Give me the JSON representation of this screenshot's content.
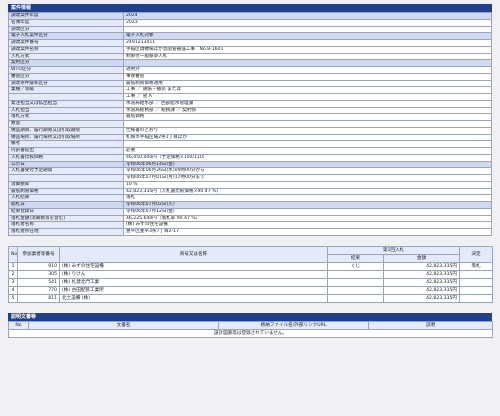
{
  "section_title": "案件情報",
  "info_rows": [
    {
      "label": "調達案件年度",
      "value": "2024",
      "hl": true
    },
    {
      "label": "名簿年度",
      "value": "2023"
    },
    {
      "label": "調達区分",
      "value": ""
    },
    {
      "label": "電子入札案件区分",
      "value": "電子入札対象",
      "hl": true
    },
    {
      "label": "調達案件番号",
      "value": "2491213411"
    },
    {
      "label": "調達案件名称",
      "value": "手稲区瑞穂場ほか急閉管補強工事　No.8-1601"
    },
    {
      "label": "入札方式",
      "value": "制限付一般競争入札"
    },
    {
      "label": "契約区分",
      "value": "",
      "hl": true
    },
    {
      "label": "WTO区分",
      "value": "適用外"
    },
    {
      "label": "審査区分",
      "value": "事後審査"
    },
    {
      "label": "調達条件緩和区分",
      "value": "最低制限価格適用"
    },
    {
      "label": "業種／等級",
      "value": "工事 ／ 鉄筋・播装 または"
    },
    {
      "label": "",
      "value": "工事 ／ 管 A"
    },
    {
      "label": "発注担当又は払出担当",
      "value": "水道局給水部 ／ 西部配水管理課"
    },
    {
      "label": "入札担当",
      "value": "水道局総務部 ／ 総務課 ／ 契約係"
    },
    {
      "label": "落札方式",
      "value": "最低価格"
    },
    {
      "label": "数量",
      "value": ""
    },
    {
      "label": "納品期限、履行期限又は引取期限",
      "value": "仕様書のとおり"
    },
    {
      "label": "納品場所、履行場所又は引取場所",
      "value": "札幌市手稲区曙2条1丁目ほか"
    },
    {
      "label": "備考",
      "value": ""
    },
    {
      "label": "内訳書提出",
      "value": "必要"
    },
    {
      "label": "入札書比較価格",
      "value": "46,450,000円（予定価格×100/110）"
    },
    {
      "label": "公示日",
      "value": "令和06年06月14日(金)",
      "hl": true
    },
    {
      "label": "入札書受付予定期間",
      "value": "令和06年06月26日(水)09時00分から"
    },
    {
      "label": "",
      "value": "令和06年07月01日(月)17時00分まで"
    },
    {
      "label": "消費税率",
      "value": "10 %"
    },
    {
      "label": "最低制限価格",
      "value": "42,823,335円（入札書比較価格×90.47 %）"
    },
    {
      "label": "入札結果",
      "value": "落札"
    },
    {
      "label": "開札日",
      "value": "令和06年07月02日(火)",
      "hl": true
    },
    {
      "label": "結果登録日",
      "value": "令和06年07月12日(金)"
    },
    {
      "label": "落札金額(消費税等を含む)",
      "value": "46,225,640円（落札率 90.47 %）"
    },
    {
      "label": "落札者名称",
      "value": "(株) みずの住宅設備"
    },
    {
      "label": "落札者所在地",
      "value": "豊平区豊平3条7丁目2-17"
    }
  ],
  "bid_table": {
    "headers": {
      "no": "No",
      "member": "参加業者等番号",
      "name": "商号又は名称",
      "round": "第1回入札",
      "result": "結果",
      "amount": "金額",
      "decision": "決定"
    },
    "rows": [
      {
        "no": "1",
        "member": "910",
        "name": "(株) みずの住宅設備",
        "result": "くじ",
        "amount": "42,823,335円",
        "decision": "落札"
      },
      {
        "no": "2",
        "member": "305",
        "name": "(株) りけん",
        "result": "",
        "amount": "42,823,335円",
        "decision": ""
      },
      {
        "no": "3",
        "member": "541",
        "name": "(株) 札建北門工業",
        "result": "",
        "amount": "42,823,335円",
        "decision": ""
      },
      {
        "no": "4",
        "member": "770",
        "name": "(株) 古田配管工業所",
        "result": "",
        "amount": "42,823,335円",
        "decision": ""
      },
      {
        "no": "5",
        "member": "811",
        "name": "北土設備 (株)",
        "result": "",
        "amount": "42,823,335円",
        "decision": ""
      }
    ]
  },
  "docs_section_title": "説明文書等",
  "docs_table": {
    "headers": {
      "no": "No",
      "doc": "文書名",
      "file": "格納ファイル名/外部リンクURL",
      "desc": "説明"
    },
    "empty_message": "設計図書等は登録されていません。"
  }
}
